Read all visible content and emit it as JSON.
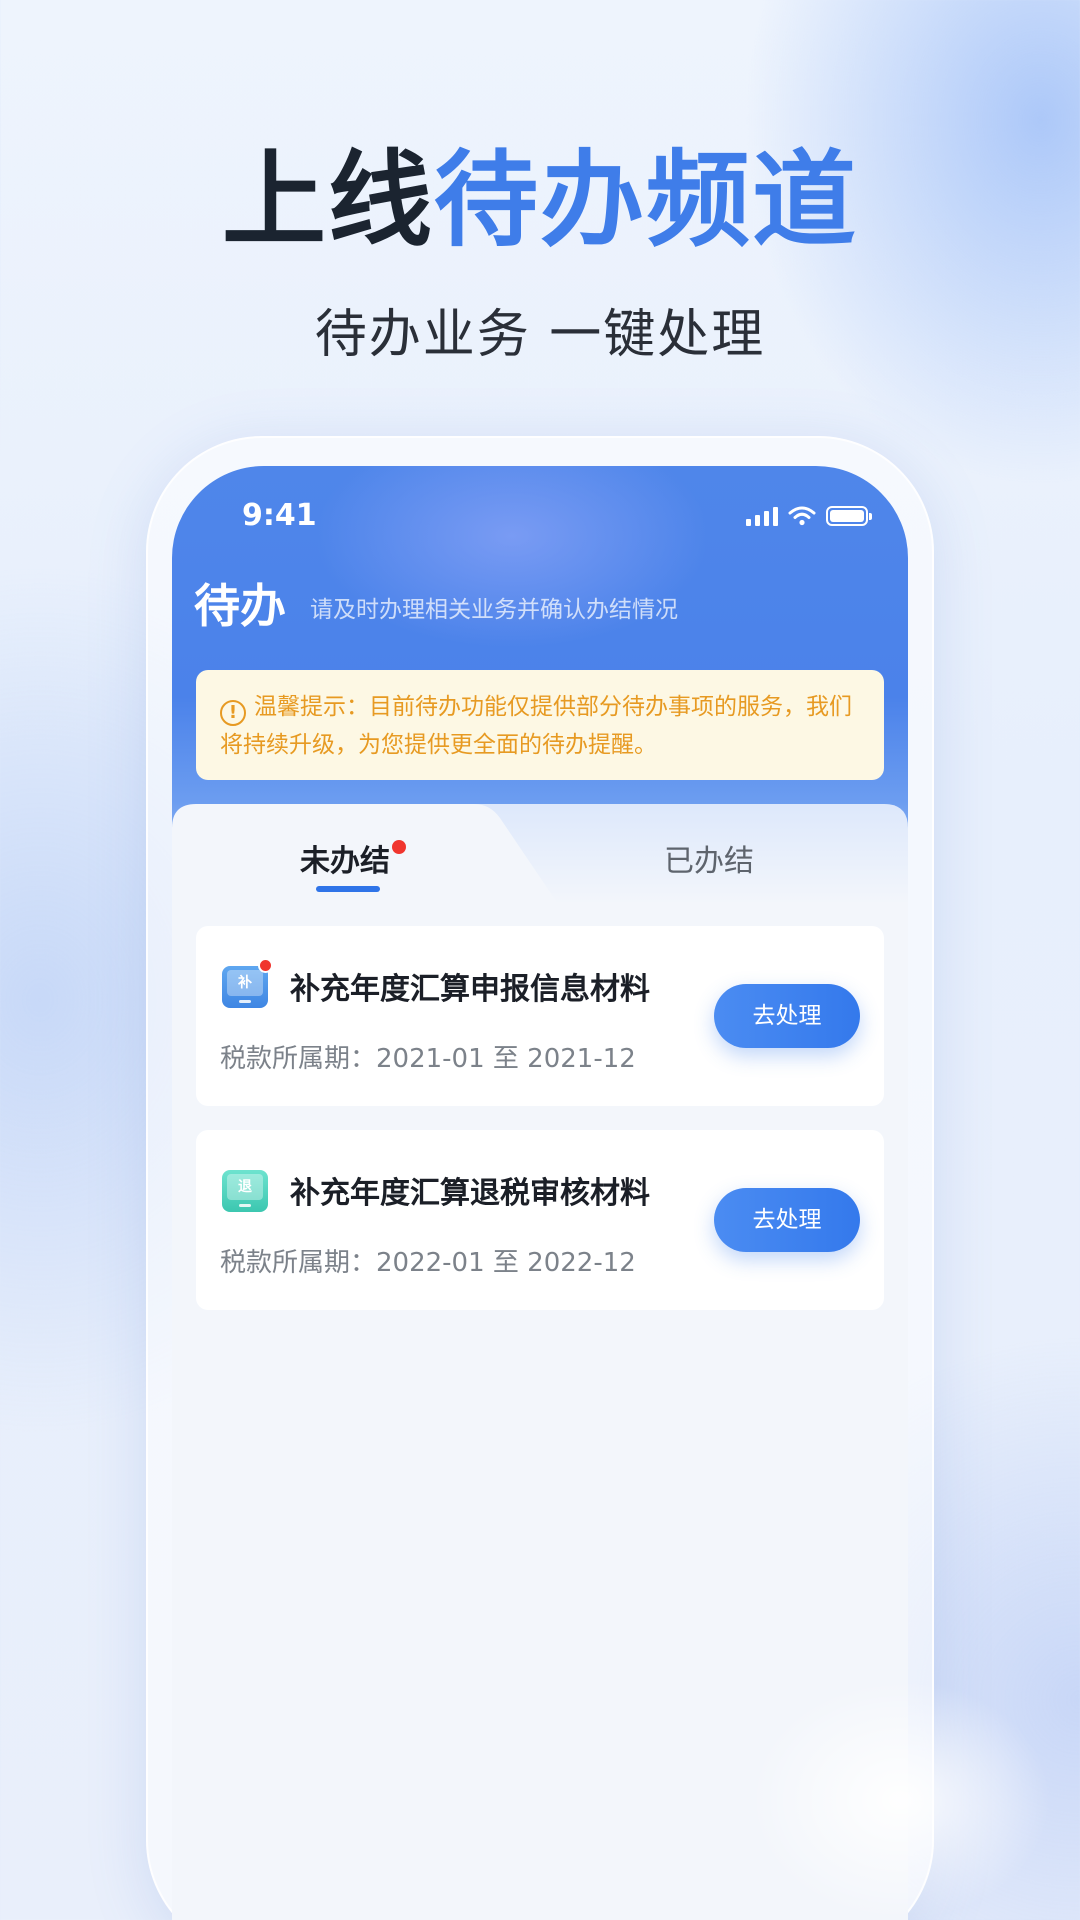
{
  "promo": {
    "headline_dark": "上线",
    "headline_blue": "待办频道",
    "subheadline": "待办业务 一键处理"
  },
  "status_bar": {
    "time": "9:41"
  },
  "header": {
    "title": "待办",
    "subtitle": "请及时办理相关业务并确认办结情况"
  },
  "notice": {
    "icon": "!",
    "text": "温馨提示：目前待办功能仅提供部分待办事项的服务，我们将持续升级，为您提供更全面的待办提醒。"
  },
  "tabs": [
    {
      "label": "未办结",
      "active": true,
      "has_badge": true
    },
    {
      "label": "已办结",
      "active": false
    }
  ],
  "tasks": [
    {
      "icon_glyph": "补",
      "icon_color": "#3f86e3",
      "has_badge": true,
      "title": "补充年度汇算申报信息材料",
      "period": "税款所属期：2021-01 至 2021-12",
      "action": "去处理"
    },
    {
      "icon_glyph": "退",
      "icon_color": "#3cc7b0",
      "has_badge": false,
      "title": "补充年度汇算退税审核材料",
      "period": "税款所属期：2022-01 至 2022-12",
      "action": "去处理"
    }
  ],
  "colors": {
    "accent": "#2f74e8",
    "notice_text": "#e79a22",
    "badge": "#f0352e"
  }
}
